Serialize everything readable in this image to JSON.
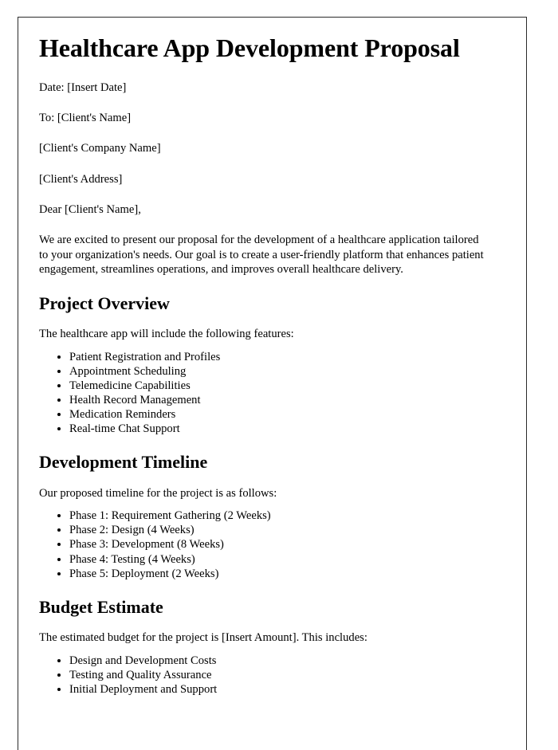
{
  "document": {
    "title": "Healthcare App Development Proposal",
    "meta_lines": [
      "Date: [Insert Date]",
      "To: [Client's Name]",
      "[Client's Company Name]",
      "[Client's Address]",
      "Dear [Client's Name],"
    ],
    "intro_paragraph": "We are excited to present our proposal for the development of a healthcare application tailored to your organization's needs. Our goal is to create a user-friendly platform that enhances patient engagement, streamlines operations, and improves overall healthcare delivery.",
    "sections": [
      {
        "heading": "Project Overview",
        "lead": "The healthcare app will include the following features:",
        "items": [
          "Patient Registration and Profiles",
          "Appointment Scheduling",
          "Telemedicine Capabilities",
          "Health Record Management",
          "Medication Reminders",
          "Real-time Chat Support"
        ]
      },
      {
        "heading": "Development Timeline",
        "lead": "Our proposed timeline for the project is as follows:",
        "items": [
          "Phase 1: Requirement Gathering (2 Weeks)",
          "Phase 2: Design (4 Weeks)",
          "Phase 3: Development (8 Weeks)",
          "Phase 4: Testing (4 Weeks)",
          "Phase 5: Deployment (2 Weeks)"
        ]
      },
      {
        "heading": "Budget Estimate",
        "lead": "The estimated budget for the project is [Insert Amount]. This includes:",
        "items": [
          "Design and Development Costs",
          "Testing and Quality Assurance",
          "Initial Deployment and Support"
        ]
      }
    ]
  },
  "colors": {
    "page_background": "#ffffff",
    "text": "#000000",
    "page_border": "#2b2b2b"
  }
}
